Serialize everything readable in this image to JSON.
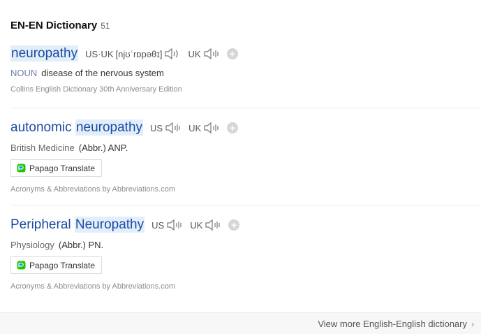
{
  "section": {
    "title": "EN-EN Dictionary",
    "count": "51"
  },
  "entries": [
    {
      "word_plain": "",
      "word_highlight": "neuropathy",
      "pron_label": "US·UK",
      "phonetic": "[njʊˈrɒpəθɪ]",
      "pron2_label": "UK",
      "pos": "NOUN",
      "definition": "disease of the nervous system",
      "source": "Collins English Dictionary 30th Anniversary Edition"
    },
    {
      "word_plain": "autonomic ",
      "word_highlight": "neuropathy",
      "pron_label": "US",
      "pron2_label": "UK",
      "field": "British Medicine",
      "definition": "(Abbr.) ANP.",
      "translate_label": "Papago Translate",
      "source": "Acronyms & Abbreviations by Abbreviations.com"
    },
    {
      "word_plain": "Peripheral ",
      "word_highlight": "Neuropathy",
      "pron_label": "US",
      "pron2_label": "UK",
      "field": "Physiology",
      "definition": "(Abbr.) PN.",
      "translate_label": "Papago Translate",
      "source": "Acronyms & Abbreviations by Abbreviations.com"
    }
  ],
  "footer": {
    "more_label": "View more English-English dictionary",
    "chevron": "›"
  },
  "colors": {
    "word": "#1a4ca3",
    "highlight": "#e3eefb",
    "papago_green": "#1ec800",
    "papago_blue": "#1e90ff"
  },
  "icons": {
    "speaker": "speaker-icon",
    "add": "plus-icon",
    "papago": "papago-logo-icon",
    "chevron": "chevron-right-icon"
  }
}
